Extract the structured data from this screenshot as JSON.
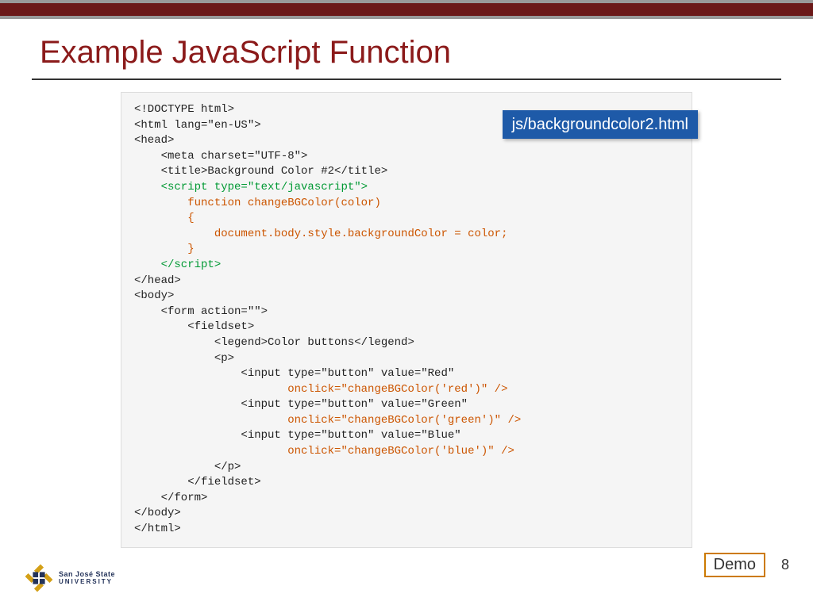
{
  "slide": {
    "title": "Example JavaScript Function",
    "filename_badge": "js/backgroundcolor2.html",
    "demo_label": "Demo",
    "page_number": "8"
  },
  "logo": {
    "line1": "San José State",
    "line2": "UNIVERSITY"
  },
  "code": {
    "l01": "<!DOCTYPE html>",
    "l02": "<html lang=\"en-US\">",
    "l03": "<head>",
    "l04": "    <meta charset=\"UTF-8\">",
    "l05": "    <title>Background Color #2</title>",
    "l06": "    <script type=\"text/javascript\">",
    "l07": "        function changeBGColor(color)",
    "l08": "        {",
    "l09": "            document.body.style.backgroundColor = color;",
    "l10": "        }",
    "l11": "    </script>",
    "l12": "</head>",
    "l13": "",
    "l14": "<body>",
    "l15": "    <form action=\"\">",
    "l16": "        <fieldset>",
    "l17": "            <legend>Color buttons</legend>",
    "l18": "            <p>",
    "l19a": "                <input type=\"button\" value=\"Red\"",
    "l19b": "                       onclick=\"changeBGColor('red')\" />",
    "l20a": "                <input type=\"button\" value=\"Green\"",
    "l20b": "                       onclick=\"changeBGColor('green')\" />",
    "l21a": "                <input type=\"button\" value=\"Blue\"",
    "l21b": "                       onclick=\"changeBGColor('blue')\" />",
    "l22": "            </p>",
    "l23": "        </fieldset>",
    "l24": "    </form>",
    "l25": "</body>",
    "l26": "</html>"
  }
}
